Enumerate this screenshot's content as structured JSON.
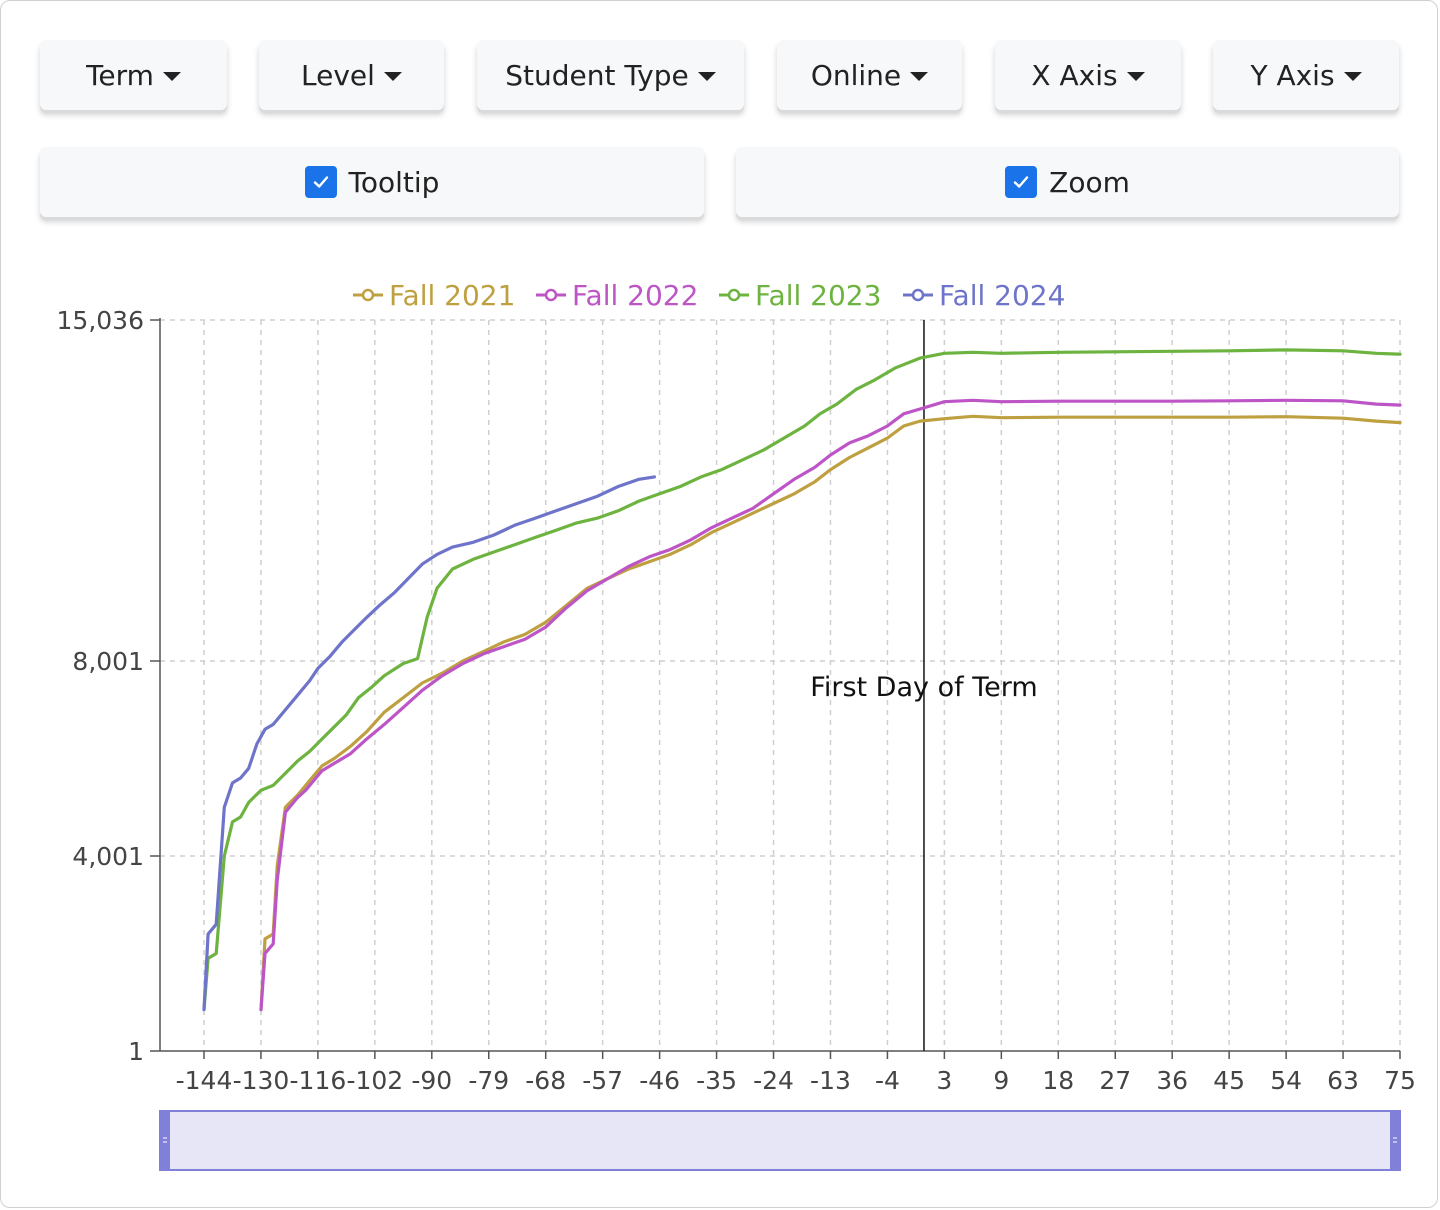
{
  "toolbar": {
    "term_label": "Term",
    "level_label": "Level",
    "student_type_label": "Student Type",
    "online_label": "Online",
    "xaxis_label": "X Axis",
    "yaxis_label": "Y Axis",
    "tooltip_label": "Tooltip",
    "zoom_label": "Zoom",
    "tooltip_checked": true,
    "zoom_checked": true
  },
  "colors": {
    "accent": "#1a73e8",
    "zoom_fill": "#e6e6f7",
    "zoom_border": "#8080d8"
  },
  "chart_data": {
    "type": "line",
    "title": "",
    "xlabel": "",
    "ylabel": "",
    "xlim": [
      -147,
      76
    ],
    "ylim": [
      1,
      15036
    ],
    "x_ticks": [
      -144,
      -130,
      -116,
      -102,
      -90,
      -79,
      -68,
      -57,
      -46,
      -35,
      -24,
      -13,
      -4,
      3,
      9,
      18,
      27,
      36,
      45,
      54,
      63,
      75
    ],
    "y_ticks": [
      1,
      4001,
      8001,
      15036
    ],
    "y_tick_labels": [
      "1",
      "4,001",
      "8,001",
      "15,036"
    ],
    "grid": true,
    "legend_position": "top",
    "annotation": {
      "x": 0,
      "text": "First Day of Term"
    },
    "series": [
      {
        "name": "Fall 2021",
        "color": "#bfa040",
        "points": [
          [
            -130,
            850
          ],
          [
            -129,
            2300
          ],
          [
            -127,
            2400
          ],
          [
            -126,
            3800
          ],
          [
            -124,
            5000
          ],
          [
            -121,
            5250
          ],
          [
            -119,
            5450
          ],
          [
            -117,
            5650
          ],
          [
            -115,
            5850
          ],
          [
            -112,
            6000
          ],
          [
            -108,
            6250
          ],
          [
            -104,
            6550
          ],
          [
            -100,
            6950
          ],
          [
            -96,
            7250
          ],
          [
            -92,
            7550
          ],
          [
            -88,
            7750
          ],
          [
            -84,
            8000
          ],
          [
            -80,
            8200
          ],
          [
            -76,
            8400
          ],
          [
            -72,
            8550
          ],
          [
            -68,
            8800
          ],
          [
            -64,
            9150
          ],
          [
            -60,
            9500
          ],
          [
            -56,
            9700
          ],
          [
            -52,
            9900
          ],
          [
            -48,
            10050
          ],
          [
            -44,
            10200
          ],
          [
            -40,
            10400
          ],
          [
            -36,
            10650
          ],
          [
            -32,
            10850
          ],
          [
            -28,
            11050
          ],
          [
            -24,
            11250
          ],
          [
            -20,
            11450
          ],
          [
            -16,
            11700
          ],
          [
            -13,
            11950
          ],
          [
            -10,
            12200
          ],
          [
            -7,
            12400
          ],
          [
            -4,
            12600
          ],
          [
            -2,
            12850
          ],
          [
            0,
            12950
          ],
          [
            3,
            13000
          ],
          [
            6,
            13050
          ],
          [
            9,
            13020
          ],
          [
            18,
            13030
          ],
          [
            27,
            13030
          ],
          [
            36,
            13030
          ],
          [
            45,
            13030
          ],
          [
            54,
            13040
          ],
          [
            63,
            13010
          ],
          [
            70,
            12950
          ],
          [
            76,
            12920
          ]
        ]
      },
      {
        "name": "Fall 2022",
        "color": "#bd55c7",
        "points": [
          [
            -130,
            850
          ],
          [
            -129,
            2000
          ],
          [
            -127,
            2200
          ],
          [
            -126,
            3500
          ],
          [
            -124,
            4900
          ],
          [
            -121,
            5200
          ],
          [
            -119,
            5350
          ],
          [
            -117,
            5550
          ],
          [
            -115,
            5750
          ],
          [
            -112,
            5900
          ],
          [
            -108,
            6100
          ],
          [
            -104,
            6400
          ],
          [
            -100,
            6700
          ],
          [
            -96,
            7050
          ],
          [
            -92,
            7400
          ],
          [
            -88,
            7700
          ],
          [
            -84,
            7950
          ],
          [
            -80,
            8150
          ],
          [
            -76,
            8300
          ],
          [
            -72,
            8450
          ],
          [
            -68,
            8700
          ],
          [
            -64,
            9100
          ],
          [
            -60,
            9450
          ],
          [
            -56,
            9700
          ],
          [
            -52,
            9950
          ],
          [
            -48,
            10150
          ],
          [
            -44,
            10300
          ],
          [
            -40,
            10500
          ],
          [
            -36,
            10750
          ],
          [
            -32,
            10950
          ],
          [
            -28,
            11150
          ],
          [
            -24,
            11450
          ],
          [
            -20,
            11750
          ],
          [
            -16,
            12000
          ],
          [
            -13,
            12250
          ],
          [
            -10,
            12500
          ],
          [
            -7,
            12650
          ],
          [
            -4,
            12850
          ],
          [
            -2,
            13100
          ],
          [
            0,
            13200
          ],
          [
            3,
            13350
          ],
          [
            6,
            13380
          ],
          [
            9,
            13350
          ],
          [
            18,
            13360
          ],
          [
            27,
            13360
          ],
          [
            36,
            13360
          ],
          [
            45,
            13370
          ],
          [
            54,
            13380
          ],
          [
            63,
            13370
          ],
          [
            70,
            13300
          ],
          [
            76,
            13280
          ]
        ]
      },
      {
        "name": "Fall 2023",
        "color": "#6db33f",
        "points": [
          [
            -144,
            850
          ],
          [
            -143,
            1900
          ],
          [
            -141,
            2000
          ],
          [
            -139,
            4000
          ],
          [
            -137,
            4700
          ],
          [
            -135,
            4800
          ],
          [
            -133,
            5100
          ],
          [
            -130,
            5350
          ],
          [
            -127,
            5450
          ],
          [
            -124,
            5700
          ],
          [
            -121,
            5950
          ],
          [
            -118,
            6150
          ],
          [
            -115,
            6400
          ],
          [
            -112,
            6650
          ],
          [
            -109,
            6900
          ],
          [
            -106,
            7250
          ],
          [
            -103,
            7450
          ],
          [
            -100,
            7700
          ],
          [
            -96,
            7950
          ],
          [
            -93,
            8050
          ],
          [
            -91,
            8900
          ],
          [
            -89,
            9500
          ],
          [
            -86,
            9900
          ],
          [
            -82,
            10100
          ],
          [
            -78,
            10250
          ],
          [
            -74,
            10400
          ],
          [
            -70,
            10550
          ],
          [
            -66,
            10700
          ],
          [
            -62,
            10850
          ],
          [
            -58,
            10950
          ],
          [
            -54,
            11100
          ],
          [
            -50,
            11300
          ],
          [
            -46,
            11450
          ],
          [
            -42,
            11600
          ],
          [
            -38,
            11800
          ],
          [
            -34,
            11950
          ],
          [
            -30,
            12150
          ],
          [
            -26,
            12350
          ],
          [
            -22,
            12600
          ],
          [
            -18,
            12850
          ],
          [
            -15,
            13100
          ],
          [
            -12,
            13300
          ],
          [
            -9,
            13600
          ],
          [
            -6,
            13800
          ],
          [
            -3,
            14050
          ],
          [
            0,
            14250
          ],
          [
            3,
            14350
          ],
          [
            6,
            14370
          ],
          [
            9,
            14350
          ],
          [
            18,
            14370
          ],
          [
            27,
            14380
          ],
          [
            36,
            14390
          ],
          [
            45,
            14400
          ],
          [
            54,
            14420
          ],
          [
            63,
            14400
          ],
          [
            70,
            14350
          ],
          [
            76,
            14330
          ]
        ]
      },
      {
        "name": "Fall 2024",
        "color": "#6d74c9",
        "points": [
          [
            -144,
            850
          ],
          [
            -143,
            2400
          ],
          [
            -141,
            2600
          ],
          [
            -139,
            5000
          ],
          [
            -137,
            5500
          ],
          [
            -135,
            5600
          ],
          [
            -133,
            5800
          ],
          [
            -131,
            6300
          ],
          [
            -129,
            6600
          ],
          [
            -127,
            6700
          ],
          [
            -124,
            7000
          ],
          [
            -121,
            7300
          ],
          [
            -118,
            7600
          ],
          [
            -116,
            7850
          ],
          [
            -113,
            8100
          ],
          [
            -110,
            8400
          ],
          [
            -107,
            8650
          ],
          [
            -104,
            8900
          ],
          [
            -101,
            9150
          ],
          [
            -98,
            9400
          ],
          [
            -95,
            9700
          ],
          [
            -92,
            10000
          ],
          [
            -89,
            10200
          ],
          [
            -86,
            10350
          ],
          [
            -82,
            10450
          ],
          [
            -78,
            10600
          ],
          [
            -74,
            10800
          ],
          [
            -70,
            10950
          ],
          [
            -66,
            11100
          ],
          [
            -62,
            11250
          ],
          [
            -58,
            11400
          ],
          [
            -54,
            11600
          ],
          [
            -50,
            11750
          ],
          [
            -47,
            11800
          ]
        ]
      }
    ]
  }
}
